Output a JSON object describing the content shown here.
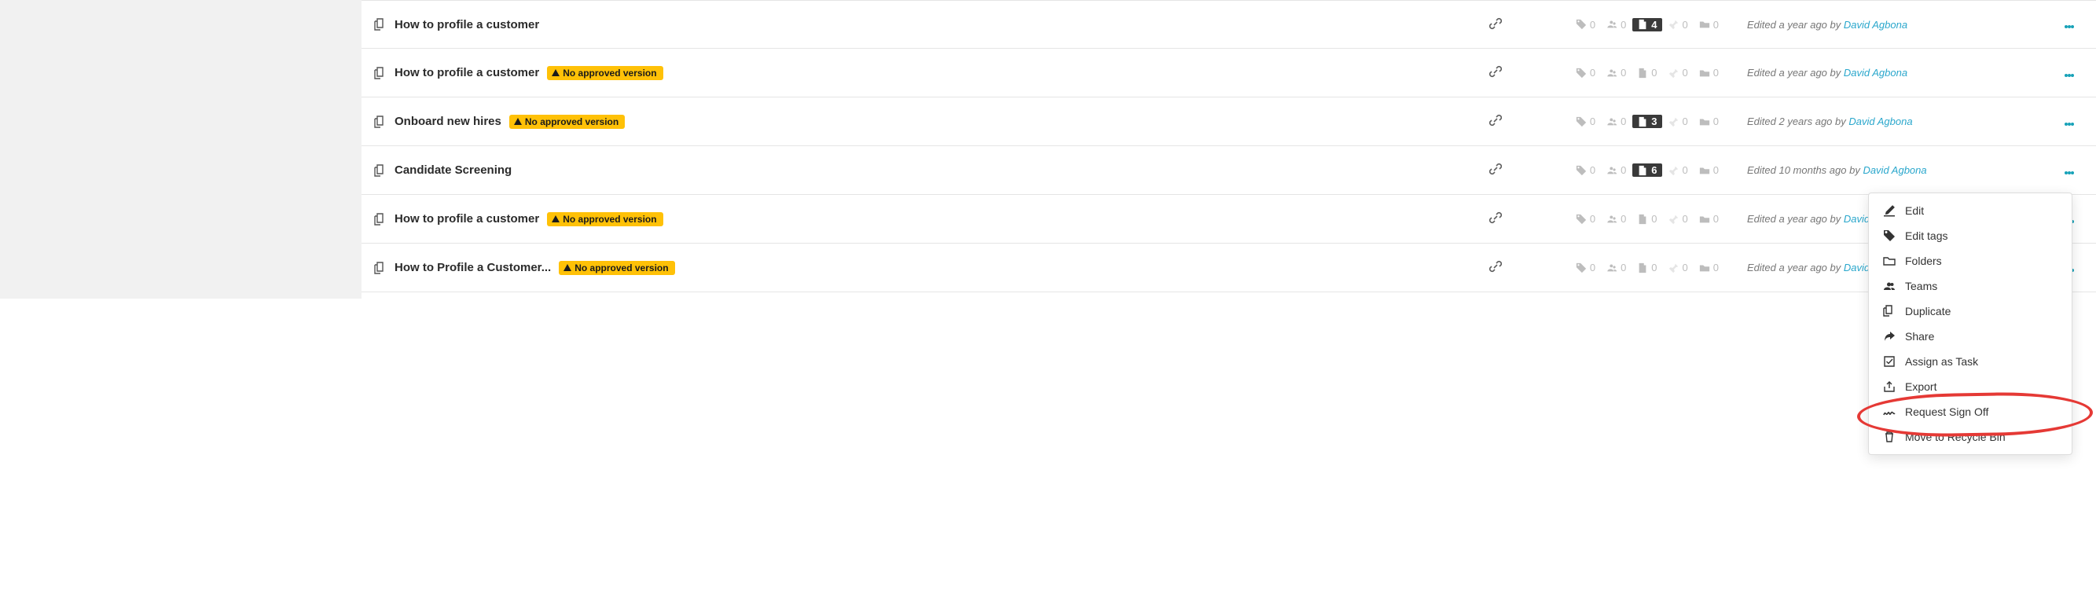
{
  "badge_text": "No approved version",
  "rows": [
    {
      "title": "How to profile a customer",
      "warn": false,
      "link": true,
      "tags": "0",
      "users": "0",
      "docs": "4",
      "docs_dark": true,
      "pins": "0",
      "folders": "0",
      "edited_prefix": "Edited a year ago by ",
      "author": "David Agbona"
    },
    {
      "title": "How to profile a customer",
      "warn": true,
      "link": true,
      "tags": "0",
      "users": "0",
      "docs": "0",
      "docs_dark": false,
      "pins": "0",
      "folders": "0",
      "edited_prefix": "Edited a year ago by ",
      "author": "David Agbona"
    },
    {
      "title": "Onboard new hires",
      "warn": true,
      "link": true,
      "tags": "0",
      "users": "0",
      "docs": "3",
      "docs_dark": true,
      "pins": "0",
      "folders": "0",
      "edited_prefix": "Edited 2 years ago by ",
      "author": "David Agbona"
    },
    {
      "title": "Candidate Screening",
      "warn": false,
      "link": true,
      "tags": "0",
      "users": "0",
      "docs": "6",
      "docs_dark": true,
      "pins": "0",
      "folders": "0",
      "edited_prefix": "Edited 10 months ago by ",
      "author": "David Agbona"
    },
    {
      "title": "How to profile a customer",
      "warn": true,
      "link": true,
      "tags": "0",
      "users": "0",
      "docs": "0",
      "docs_dark": false,
      "pins": "0",
      "folders": "0",
      "edited_prefix": "Edited a year ago by ",
      "author": "David Agbona"
    },
    {
      "title": "How to Profile a Customer...",
      "warn": true,
      "link": true,
      "tags": "0",
      "users": "0",
      "docs": "0",
      "docs_dark": false,
      "pins": "0",
      "folders": "0",
      "edited_prefix": "Edited a year ago by ",
      "author": "David Agbona"
    }
  ],
  "menu": {
    "edit": "Edit",
    "edit_tags": "Edit tags",
    "folders": "Folders",
    "teams": "Teams",
    "duplicate": "Duplicate",
    "share": "Share",
    "assign_task": "Assign as Task",
    "export": "Export",
    "request_signoff": "Request Sign Off",
    "recycle": "Move to Recycle Bin"
  },
  "highlighted_menu_item": "assign_task"
}
